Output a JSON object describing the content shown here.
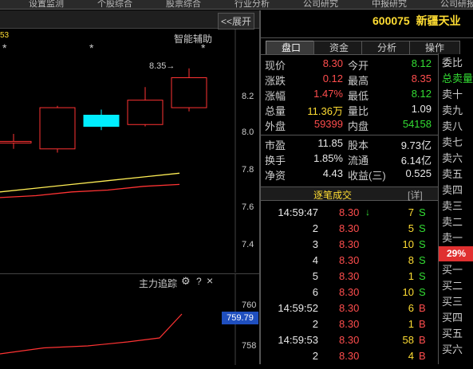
{
  "top_strip": [
    "设置监测",
    "个股综合",
    "股票综合",
    "行业分析",
    "公司研究",
    "中报研究",
    "公司研报"
  ],
  "chart_header": {
    "collapse_label": "<<展开"
  },
  "main_chart": {
    "corner_label": "53",
    "tool_label": "智能辅助",
    "stars": [
      "*",
      "*",
      "*"
    ],
    "high_marker": "8.35→",
    "y_ticks": [
      "8.2",
      "8.0",
      "7.8",
      "7.6",
      "7.4"
    ]
  },
  "chart_data": [
    {
      "type": "candlestick",
      "title": "",
      "candles": [
        {
          "open": 7.96,
          "close": 7.96,
          "high": 8.0,
          "low": 7.92,
          "color": "red"
        },
        {
          "open": 7.92,
          "close": 8.14,
          "high": 8.15,
          "low": 7.9,
          "color": "red"
        },
        {
          "open": 8.04,
          "close": 8.1,
          "high": 8.13,
          "low": 8.02,
          "color": "cyan"
        },
        {
          "open": 8.05,
          "close": 8.18,
          "high": 8.25,
          "low": 8.04,
          "color": "red"
        },
        {
          "open": 8.14,
          "close": 8.3,
          "high": 8.35,
          "low": 8.12,
          "color": "red"
        }
      ],
      "moving_averages": [
        {
          "color": "#ffee55",
          "values": [
            7.69,
            7.71,
            7.73,
            7.75,
            7.77,
            7.79
          ]
        },
        {
          "color": "#ff3333",
          "values": [
            7.66,
            7.67,
            7.69,
            7.7,
            7.72,
            7.73
          ]
        }
      ],
      "ylim": [
        7.3,
        8.6
      ]
    },
    {
      "type": "line",
      "title": "主力追踪",
      "series": [
        {
          "values": [
            757.6,
            757.9,
            758.0,
            758.2,
            758.4,
            759.6
          ]
        }
      ],
      "current_value": "759.79",
      "y_ticks": [
        "760",
        "758"
      ],
      "ylim": [
        757.4,
        760.4
      ]
    }
  ],
  "sub_chart": {
    "gear_icon": "⚙",
    "help_label": "?",
    "close_label": "×"
  },
  "stock": {
    "code": "600075",
    "name": "新疆天业"
  },
  "tabs": [
    "盘口",
    "资金",
    "分析",
    "操作"
  ],
  "quote": {
    "rows": [
      {
        "l1": "现价",
        "v1": "8.30",
        "c1": "red",
        "l2": "今开",
        "v2": "8.12",
        "c2": "green"
      },
      {
        "l1": "涨跌",
        "v1": "0.12",
        "c1": "red",
        "l2": "最高",
        "v2": "8.35",
        "c2": "red"
      },
      {
        "l1": "涨幅",
        "v1": "1.47%",
        "c1": "red",
        "l2": "最低",
        "v2": "8.12",
        "c2": "green"
      },
      {
        "l1": "总量",
        "v1": "11.36万",
        "c1": "yellow",
        "l2": "量比",
        "v2": "1.09",
        "c2": "white"
      },
      {
        "l1": "外盘",
        "v1": "59399",
        "c1": "red",
        "l2": "内盘",
        "v2": "54158",
        "c2": "green"
      },
      {
        "l1": "市盈",
        "v1": "11.85",
        "c1": "white",
        "l2": "股本",
        "v2": "9.73亿",
        "c2": "white"
      },
      {
        "l1": "换手",
        "v1": "1.85%",
        "c1": "white",
        "l2": "流通",
        "v2": "6.14亿",
        "c2": "white"
      },
      {
        "l1": "净资",
        "v1": "4.43",
        "c1": "white",
        "l2": "收益(三)",
        "v2": "0.525",
        "c2": "white"
      }
    ]
  },
  "ticker": {
    "title": "逐笔成交",
    "detail_label": "[详]",
    "rows": [
      {
        "time": "14:59:47",
        "price": "8.30",
        "arrow": "↓",
        "vol": "7",
        "side": "S"
      },
      {
        "time": "2",
        "price": "8.30",
        "arrow": "",
        "vol": "5",
        "side": "S"
      },
      {
        "time": "3",
        "price": "8.30",
        "arrow": "",
        "vol": "10",
        "side": "S"
      },
      {
        "time": "4",
        "price": "8.30",
        "arrow": "",
        "vol": "8",
        "side": "S"
      },
      {
        "time": "5",
        "price": "8.30",
        "arrow": "",
        "vol": "1",
        "side": "S"
      },
      {
        "time": "6",
        "price": "8.30",
        "arrow": "",
        "vol": "10",
        "side": "S"
      },
      {
        "time": "14:59:52",
        "price": "8.30",
        "arrow": "",
        "vol": "6",
        "side": "B"
      },
      {
        "time": "2",
        "price": "8.30",
        "arrow": "",
        "vol": "1",
        "side": "B"
      },
      {
        "time": "14:59:53",
        "price": "8.30",
        "arrow": "",
        "vol": "58",
        "side": "B"
      },
      {
        "time": "2",
        "price": "8.30",
        "arrow": "",
        "vol": "4",
        "side": "B"
      }
    ]
  },
  "orderbook": {
    "labels": [
      "委比",
      "总卖量",
      "卖十",
      "卖九",
      "卖八",
      "卖七",
      "卖六",
      "卖五",
      "卖四",
      "卖三",
      "卖二",
      "卖一",
      "",
      "买一",
      "买二",
      "买三",
      "买四",
      "买五",
      "买六"
    ],
    "badge": "29%",
    "colors": {
      "total_sell": "#33dd33",
      "badge": "#e03030"
    }
  }
}
